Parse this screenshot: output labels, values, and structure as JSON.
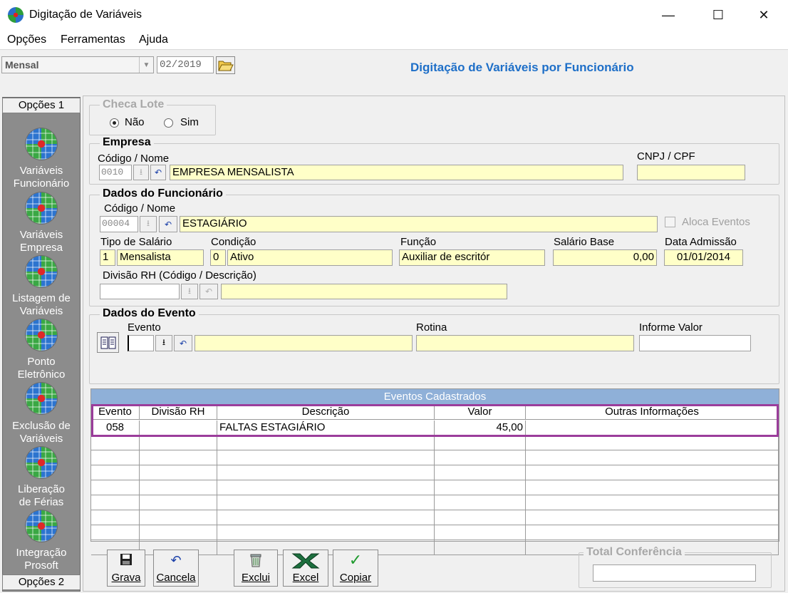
{
  "window": {
    "title": "Digitação de Variáveis",
    "minimize": "—",
    "maximize": "☐",
    "close": "✕"
  },
  "menu": [
    "Opções",
    "Ferramentas",
    "Ajuda"
  ],
  "toolbar": {
    "period_type": "Mensal",
    "period": "02/2019",
    "heading": "Digitação de Variáveis por Funcionário"
  },
  "sidebar": {
    "top_tab": "Opções 1",
    "bottom_tab": "Opções 2",
    "items": [
      {
        "line1": "Variáveis",
        "line2": "Funcionário"
      },
      {
        "line1": "Variáveis",
        "line2": "Empresa"
      },
      {
        "line1": "Listagem de",
        "line2": "Variáveis"
      },
      {
        "line1": "Ponto",
        "line2": "Eletrônico"
      },
      {
        "line1": "Exclusão de",
        "line2": "Variáveis"
      },
      {
        "line1": "Liberação",
        "line2": "de Férias"
      },
      {
        "line1": "Integração",
        "line2": "Prosoft"
      }
    ]
  },
  "checa_lote": {
    "legend": "Checa Lote",
    "opt_nao": "Não",
    "opt_sim": "Sim",
    "selected": "Não"
  },
  "empresa": {
    "legend": "Empresa",
    "code_label": "Código / Nome",
    "code": "0010",
    "name": "EMPRESA MENSALISTA",
    "cnpj_label": "CNPJ / CPF",
    "cnpj": ""
  },
  "funcionario": {
    "legend": "Dados do Funcionário",
    "code_label": "Código / Nome",
    "code": "00004",
    "name": "ESTAGIÁRIO",
    "aloca_label": "Aloca Eventos",
    "tipo_label": "Tipo de Salário",
    "tipo_code": "1",
    "tipo": "Mensalista",
    "cond_label": "Condição",
    "cond_code": "0",
    "cond": "Ativo",
    "funcao_label": "Função",
    "funcao": "Auxiliar de escritór",
    "salario_label": "Salário Base",
    "salario": "0,00",
    "admissao_label": "Data Admissão",
    "admissao": "01/01/2014",
    "divisao_label": "Divisão RH (Código / Descrição)"
  },
  "evento": {
    "legend": "Dados do Evento",
    "evento_label": "Evento",
    "rotina_label": "Rotina",
    "valor_label": "Informe Valor"
  },
  "grid": {
    "title": "Eventos Cadastrados",
    "columns": [
      "Evento",
      "Divisão RH",
      "Descrição",
      "Valor",
      "Outras Informações"
    ],
    "rows": [
      [
        "058",
        "",
        "FALTAS ESTAGIÁRIO",
        "45,00",
        ""
      ]
    ],
    "highlight_color": "#9b3d9b"
  },
  "buttons": {
    "grava": "Grava",
    "cancela": "Cancela",
    "exclui": "Exclui",
    "excel": "Excel",
    "copiar": "Copiar"
  },
  "total": {
    "legend": "Total Conferência",
    "value": ""
  }
}
